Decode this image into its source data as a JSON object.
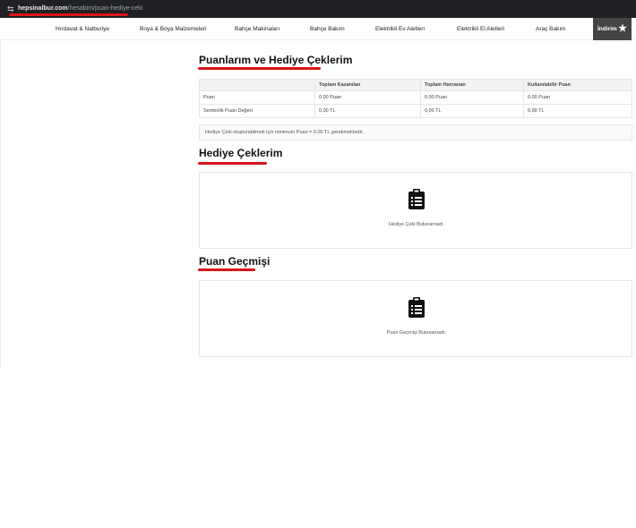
{
  "browser": {
    "url_domain": "hepsinalbur.com",
    "url_path": "/hesabim/puan-hediye-ceki"
  },
  "nav": {
    "items": [
      "Hırdavat & Nalburiye",
      "Boya & Boya Malzemeleri",
      "Bahçe Makinaları",
      "Bahçe Bakım",
      "Elektrikli Ev Aletleri",
      "Elektrikli El Aletleri",
      "Araç Bakım"
    ],
    "discount_label": "İndirim"
  },
  "points": {
    "title": "Puanlarım ve Hediye Çeklerim",
    "headers": [
      "",
      "Toplam Kazanılan",
      "Toplam Harcanan",
      "Kullanılabilir Puan"
    ],
    "rows": [
      [
        "Puan",
        "0.00 Puan",
        "0.00 Puan",
        "0.00 Puan"
      ],
      [
        "Sembolik Puan Değeri",
        "0,00 TL",
        "0,00 TL",
        "0,00 TL"
      ]
    ],
    "note": "Hediye Çeki oluşturabilmek için minimum Puan = 0.00 TL gerekmektedir."
  },
  "gift_cards": {
    "title": "Hediye Çeklerim",
    "empty_text": "Hediye Çeki Bulunamadı."
  },
  "points_history": {
    "title": "Puan Geçmişi",
    "empty_text": "Puan Geçmişi Bulunamadı."
  },
  "colors": {
    "accent": "#d8141b",
    "discount_bg": "#444444"
  }
}
